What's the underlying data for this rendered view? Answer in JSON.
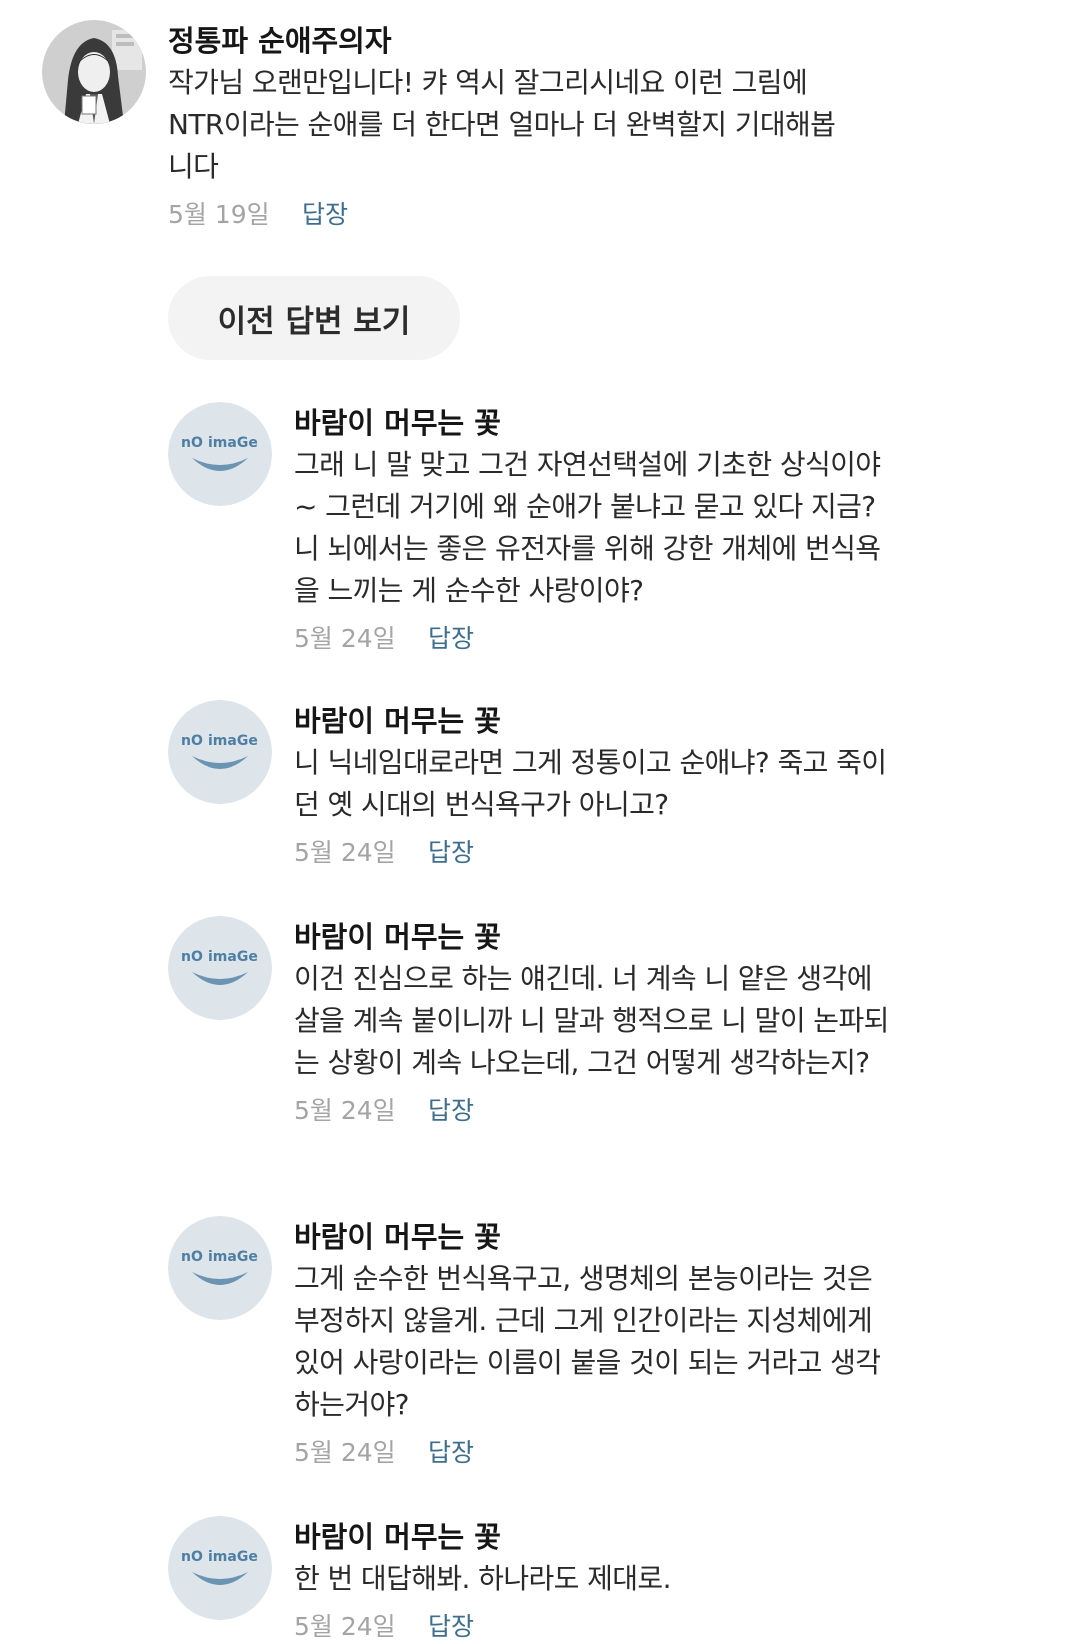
{
  "main_comment": {
    "author": "정통파 순애주의자",
    "text": "작가님 오랜만입니다! 캬 역시 잘그리시네요 이런 그림에 NTR이라는 순애를 더 한다면 얼마나 더 완벽할지 기대해봅니다",
    "date": "5월 19일",
    "reply_label": "답장"
  },
  "prev_replies_label": "이전 답변 보기",
  "no_image": {
    "left": "nO",
    "right": "imaGe"
  },
  "replies": [
    {
      "author": "바람이 머무는 꽃",
      "text": "그래 니 말 맞고 그건 자연선택설에 기초한 상식이야~ 그런데 거기에 왜 순애가 붙냐고 묻고 있다 지금? 니 뇌에서는 좋은 유전자를 위해 강한 개체에 번식욕을 느끼는 게 순수한 사랑이야?",
      "date": "5월 24일",
      "reply_label": "답장"
    },
    {
      "author": "바람이 머무는 꽃",
      "text": "니 닉네임대로라면 그게 정통이고 순애냐? 죽고 죽이던 옛 시대의 번식욕구가 아니고?",
      "date": "5월 24일",
      "reply_label": "답장"
    },
    {
      "author": "바람이 머무는 꽃",
      "text": "이건 진심으로 하는 얘긴데. 너 계속 니 얕은 생각에 살을 계속 붙이니까 니 말과 행적으로 니 말이 논파되는 상황이 계속 나오는데, 그건 어떻게 생각하는지?",
      "date": "5월 24일",
      "reply_label": "답장"
    },
    {
      "author": "바람이 머무는 꽃",
      "text": "그게 순수한 번식욕구고, 생명체의 본능이라는 것은 부정하지 않을게. 근데 그게 인간이라는 지성체에게 있어 사랑이라는 이름이 붙을 것이 되는 거라고 생각하는거야?",
      "date": "5월 24일",
      "reply_label": "답장"
    },
    {
      "author": "바람이 머무는 꽃",
      "text": "한 번 대답해봐. 하나라도 제대로.",
      "date": "5월 24일",
      "reply_label": "답장"
    }
  ]
}
